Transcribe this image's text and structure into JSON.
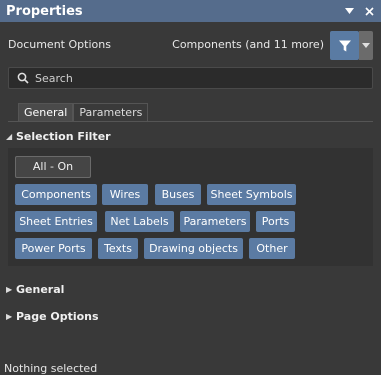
{
  "panel": {
    "title": "Properties",
    "pin_icon": "dropdown-arrow-icon",
    "close_icon": "close-icon"
  },
  "document": {
    "label": "Document Options",
    "filter_text": "Components (and 11 more)",
    "filter_icon": "funnel-icon"
  },
  "search": {
    "placeholder": "Search"
  },
  "tabs": [
    {
      "label": "General",
      "active": true
    },
    {
      "label": "Parameters",
      "active": false
    }
  ],
  "selection_filter": {
    "title": "Selection Filter",
    "all_on_label": "All - On",
    "chips": [
      "Components",
      "Wires",
      "Buses",
      "Sheet Symbols",
      "Sheet Entries",
      "Net Labels",
      "Parameters",
      "Ports",
      "Power Ports",
      "Texts",
      "Drawing objects",
      "Other"
    ]
  },
  "sections": {
    "general": "General",
    "page_options": "Page Options"
  },
  "status": "Nothing selected",
  "colors": {
    "titlebar": "#556c8c",
    "chip": "#5b7ba3",
    "background": "#393939"
  }
}
